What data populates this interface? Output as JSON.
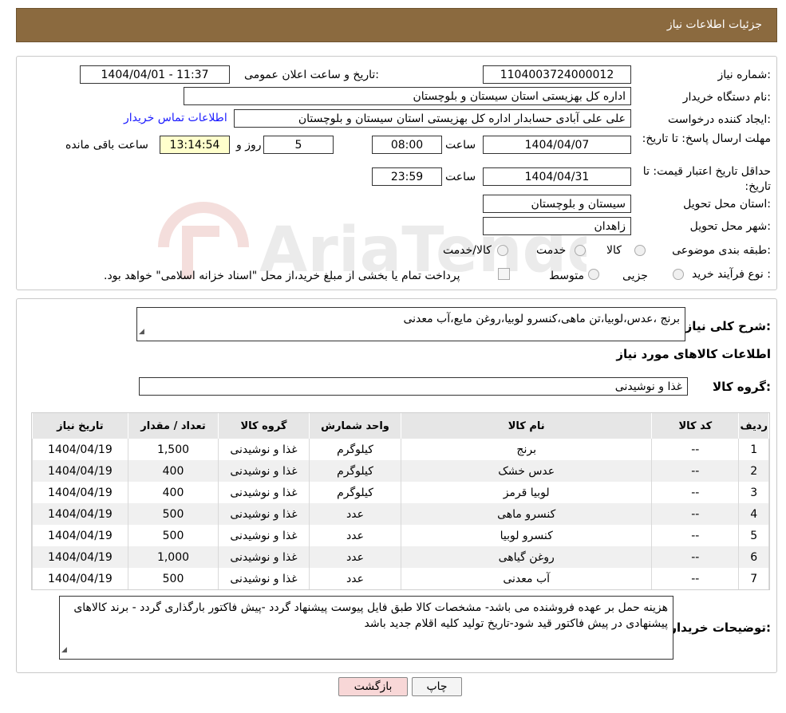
{
  "header": {
    "title": "جزئیات اطلاعات نیاز"
  },
  "form": {
    "need_number_label": "شماره نیاز:",
    "need_number": "1104003724000012",
    "announce_label": "تاریخ و ساعت اعلان عمومی:",
    "announce_value": "1404/04/01 - 11:37",
    "buyer_org_label": "نام دستگاه خریدار:",
    "buyer_org": "اداره کل بهزیستی استان سیستان و بلوچستان",
    "creator_label": "ایجاد کننده درخواست:",
    "creator": "علی علی آبادی حسابدار اداره کل بهزیستی استان سیستان و بلوچستان",
    "contact_link": "اطلاعات تماس خریدار",
    "deadline_label": "مهلت ارسال پاسخ: تا تاریخ:",
    "deadline_date": "1404/04/07",
    "time_label": "ساعت",
    "deadline_time": "08:00",
    "days_value": "5",
    "days_label": "روز و",
    "remaining_time": "13:14:54",
    "remaining_label": "ساعت باقی مانده",
    "validity_label": "حداقل تاریخ اعتبار قیمت: تا تاریخ:",
    "validity_date": "1404/04/31",
    "validity_time": "23:59",
    "province_label": "استان محل تحویل:",
    "province": "سیستان و بلوچستان",
    "city_label": "شهر محل تحویل:",
    "city": "زاهدان",
    "category_label": "طبقه بندی موضوعی:",
    "category_options": [
      "کالا",
      "خدمت",
      "کالا/خدمت"
    ],
    "process_label": "نوع فرآیند خرید :",
    "process_options": [
      "جزیی",
      "متوسط"
    ],
    "payment_note": "پرداخت تمام یا بخشی از مبلغ خرید،از محل \"اسناد خزانه اسلامی\" خواهد بود."
  },
  "summary": {
    "label": "شرح کلی نیاز:",
    "text": "برنج ،عدس،لوبیا،تن ماهی،کنسرو لوبیا،روغن مایع،آب معدنی"
  },
  "goods": {
    "section_title": "اطلاعات کالاهای مورد نیاز",
    "group_label": "گروه کالا:",
    "group_value": "غذا و نوشیدنی",
    "columns": [
      "ردیف",
      "کد کالا",
      "نام کالا",
      "واحد شمارش",
      "گروه کالا",
      "تعداد / مقدار",
      "تاریخ نیاز"
    ],
    "rows": [
      [
        "1",
        "--",
        "برنج",
        "کیلوگرم",
        "غذا و نوشیدنی",
        "1,500",
        "1404/04/19"
      ],
      [
        "2",
        "--",
        "عدس خشک",
        "کیلوگرم",
        "غذا و نوشیدنی",
        "400",
        "1404/04/19"
      ],
      [
        "3",
        "--",
        "لوبیا قرمز",
        "کیلوگرم",
        "غذا و نوشیدنی",
        "400",
        "1404/04/19"
      ],
      [
        "4",
        "--",
        "کنسرو ماهی",
        "عدد",
        "غذا و نوشیدنی",
        "500",
        "1404/04/19"
      ],
      [
        "5",
        "--",
        "کنسرو لوبیا",
        "عدد",
        "غذا و نوشیدنی",
        "500",
        "1404/04/19"
      ],
      [
        "6",
        "--",
        "روغن گیاهی",
        "عدد",
        "غذا و نوشیدنی",
        "1,000",
        "1404/04/19"
      ],
      [
        "7",
        "--",
        "آب معدنی",
        "عدد",
        "غذا و نوشیدنی",
        "500",
        "1404/04/19"
      ]
    ]
  },
  "buyer_notes": {
    "label": "توضیحات خریدار:",
    "text": "هزینه حمل بر عهده فروشنده می باشد- مشخصات کالا طبق فایل پیوست پیشنهاد گردد -پیش فاکتور بارگذاری گردد - برند کالاهای پیشنهادی در پیش فاکتور قید شود-تاریخ تولید کلیه اقلام جدید باشد"
  },
  "buttons": {
    "print": "چاپ",
    "back": "بازگشت"
  },
  "watermark": {
    "text": "AriaTender.neT"
  },
  "colors": {
    "header": "#8b6a3f",
    "link": "#1a1aff",
    "back_button": "#f8d7d7",
    "remaining": "#ffffcc"
  }
}
